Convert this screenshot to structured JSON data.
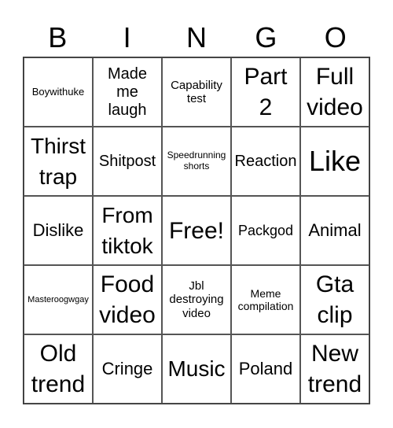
{
  "header": {
    "letters": [
      "B",
      "I",
      "N",
      "G",
      "O"
    ]
  },
  "grid": {
    "cells": [
      "Boywithuke",
      "Made me laugh",
      "Capability test",
      "Part 2",
      "Full video",
      "Thirst trap",
      "Shitpost",
      "Speedrunning shorts",
      "Reaction",
      "Like",
      "Dislike",
      "From tiktok",
      "Free!",
      "Packgod",
      "Animal",
      "Masteroogwgay",
      "Food video",
      "Jbl destroying video",
      "Meme compilation",
      "Gta clip",
      "Old trend",
      "Cringe",
      "Music",
      "Poland",
      "New trend"
    ],
    "free_space_index": 12
  }
}
